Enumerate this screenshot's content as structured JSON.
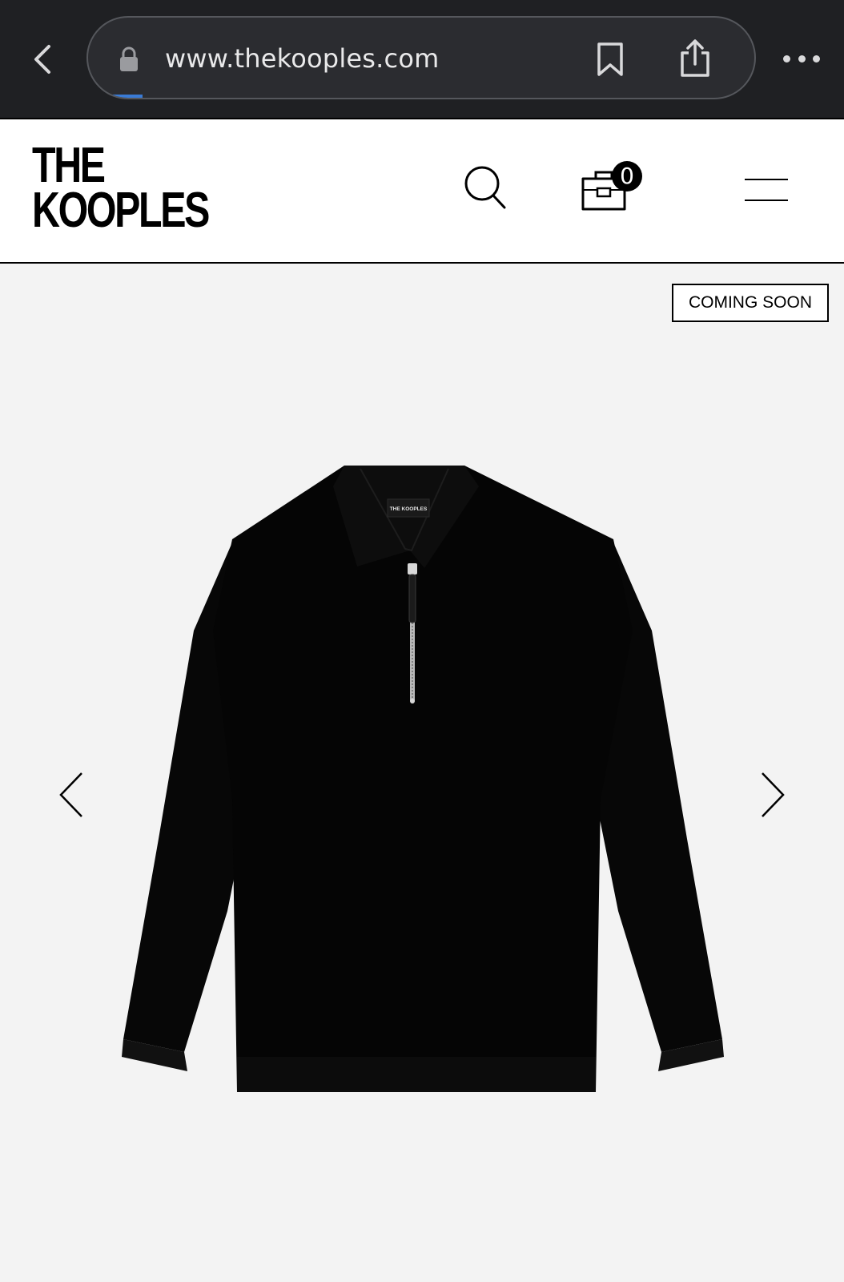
{
  "browser": {
    "url": "www.thekooples.com",
    "icons": [
      "chevron-left-icon",
      "lock-icon",
      "bookmark-icon",
      "share-icon",
      "more-icon"
    ]
  },
  "header": {
    "logo_line1": "THE",
    "logo_line2": "KOOPLES",
    "cart_count": "0",
    "icons": [
      "search-icon",
      "shopping-bag-icon",
      "hamburger-menu-icon"
    ]
  },
  "product": {
    "badge": "COMING SOON",
    "label_text": "THE KOOPLES",
    "image_alt": "black half-zip polo-collar sweater",
    "nav_icons": [
      "chevron-left-icon",
      "chevron-right-icon"
    ]
  },
  "colors": {
    "browser_bg": "#1f2023",
    "page_bg": "#f3f3f3",
    "header_bg": "#ffffff",
    "text": "#000000"
  }
}
